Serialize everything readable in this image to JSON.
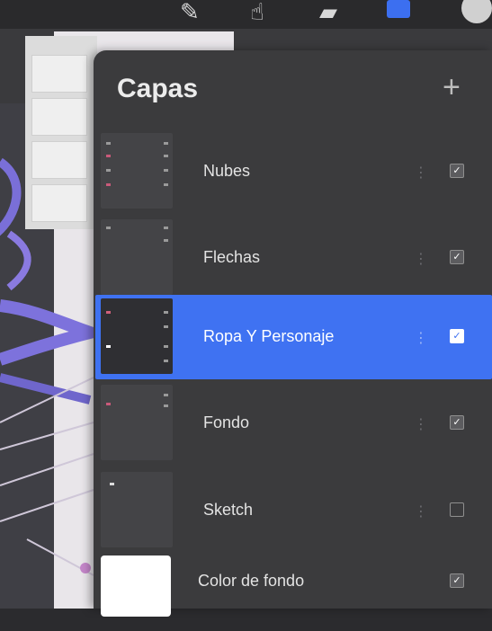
{
  "panel": {
    "title": "Capas",
    "add_icon": "plus-icon"
  },
  "toolbar": {
    "icons": [
      "brush-icon",
      "smudge-icon",
      "eraser-icon",
      "layers-icon",
      "color-icon"
    ],
    "layers_color": "#3c6ff0"
  },
  "layers": [
    {
      "name": "Nubes",
      "visible": true,
      "selected": false
    },
    {
      "name": "Flechas",
      "visible": true,
      "selected": false
    },
    {
      "name": "Ropa Y Personaje",
      "visible": true,
      "selected": true
    },
    {
      "name": "Fondo",
      "visible": true,
      "selected": false
    },
    {
      "name": "Sketch",
      "visible": false,
      "selected": false
    },
    {
      "name": "Color de fondo",
      "visible": true,
      "selected": false
    }
  ],
  "colors": {
    "accent": "#3f72f2",
    "panel_bg": "#3b3b3d"
  }
}
